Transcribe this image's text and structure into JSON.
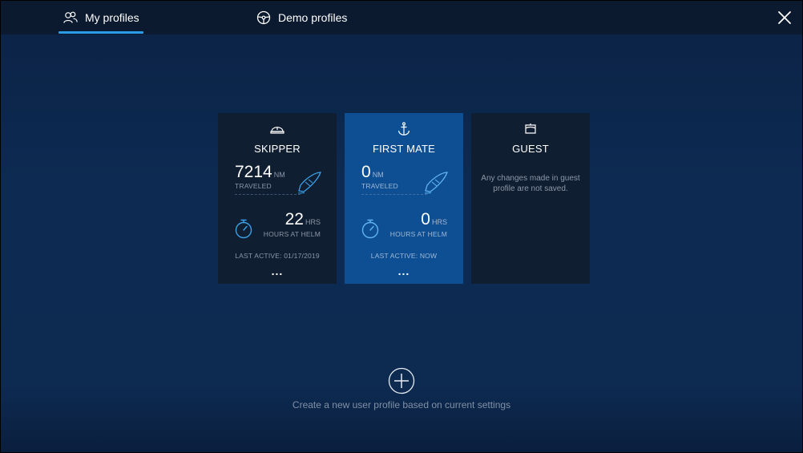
{
  "tabs": [
    {
      "label": "My profiles",
      "icon": "users-icon",
      "active": true
    },
    {
      "label": "Demo profiles",
      "icon": "steering-wheel-icon",
      "active": false
    }
  ],
  "close_icon": "close-icon",
  "accent_color": "#2c9ce6",
  "profiles": [
    {
      "title": "SKIPPER",
      "icon": "captain-hat-icon",
      "distance": "7214",
      "distance_unit": "NM",
      "distance_label": "TRAVELED",
      "hours": "22",
      "hours_unit": "HRS",
      "hours_label": "HOURS AT HELM",
      "last_active": "LAST ACTIVE: 01/17/2019",
      "more": "...",
      "active": false
    },
    {
      "title": "FIRST MATE",
      "icon": "anchor-icon",
      "distance": "0",
      "distance_unit": "NM",
      "distance_label": "TRAVELED",
      "hours": "0",
      "hours_unit": "HRS",
      "hours_label": "HOURS AT HELM",
      "last_active": "LAST ACTIVE: NOW",
      "more": "...",
      "active": true
    },
    {
      "title": "GUEST",
      "icon": "guest-cap-icon",
      "note": "Any changes made in guest profile are not saved.",
      "active": false
    }
  ],
  "add_profile": {
    "icon": "plus-circle-icon",
    "caption": "Create a new user profile based on current settings"
  }
}
